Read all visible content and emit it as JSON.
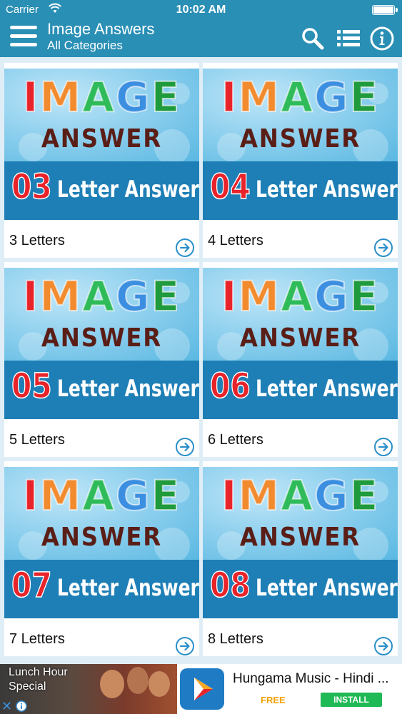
{
  "status_bar": {
    "carrier": "Carrier",
    "time": "10:02 AM"
  },
  "nav": {
    "title": "Image Answers",
    "subtitle": "All Categories",
    "icons": [
      "menu-icon",
      "search-icon",
      "list-icon",
      "info-icon"
    ]
  },
  "banner": {
    "image_word_letters": [
      "I",
      "M",
      "A",
      "G",
      "E"
    ],
    "image_word_colors": [
      "#e8232a",
      "#f28a2e",
      "#2fbb5a",
      "#3c8fe0",
      "#1f9a3c"
    ],
    "answer_word": "ANSWER",
    "suffix": "Letter Answers"
  },
  "categories": [
    {
      "number": "03",
      "label": "3 Letters"
    },
    {
      "number": "04",
      "label": "4 Letters"
    },
    {
      "number": "05",
      "label": "5 Letters"
    },
    {
      "number": "06",
      "label": "6 Letters"
    },
    {
      "number": "07",
      "label": "7 Letters"
    },
    {
      "number": "08",
      "label": "8 Letters"
    }
  ],
  "ad": {
    "left_text": "Lunch Hour Special",
    "app_title": "Hungama Music - Hindi ...",
    "price": "FREE",
    "install_label": "INSTALL"
  },
  "colors": {
    "nav_bg": "#2a8fb5",
    "banner_blue": "#1e7fb6",
    "number_red": "#e8232a",
    "arrow_blue": "#2a8fc9"
  }
}
